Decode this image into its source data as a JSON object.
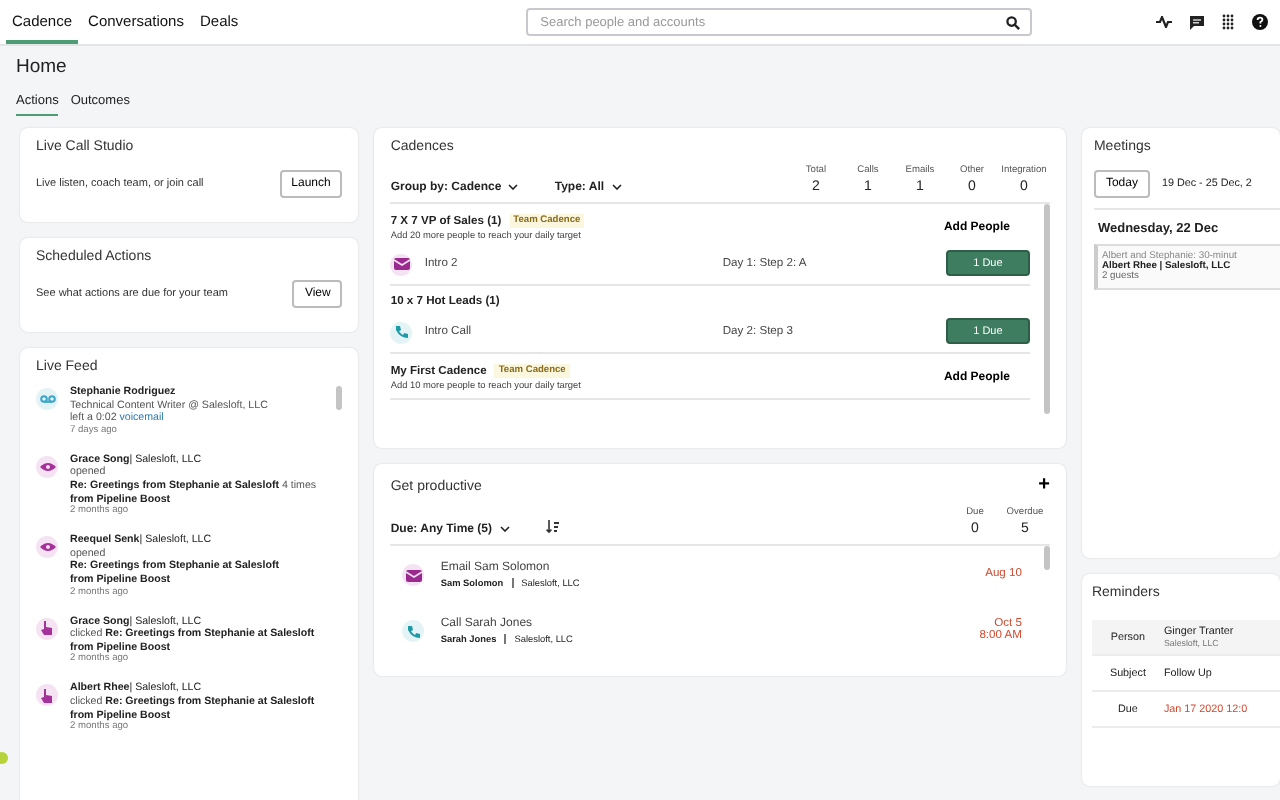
{
  "nav": {
    "tabs": [
      {
        "label": "Cadence",
        "selected": true
      },
      {
        "label": "Conversations",
        "selected": false
      },
      {
        "label": "Deals",
        "selected": false
      }
    ],
    "search": {
      "placeholder": "Search people and accounts"
    }
  },
  "page": {
    "title": "Home",
    "tabs": [
      {
        "label": "Actions",
        "selected": true
      },
      {
        "label": "Outcomes",
        "selected": false
      }
    ]
  },
  "live_call_studio": {
    "title": "Live Call Studio",
    "text": "Live listen, coach team, or join call",
    "button": "Launch"
  },
  "scheduled_actions": {
    "title": "Scheduled Actions",
    "text": "See what actions are due for your team",
    "button": "View"
  },
  "live_feed": {
    "title": "Live Feed",
    "items": [
      {
        "kind": "voicemail",
        "name": "**Stephanie Rodriguez**",
        "lines": [
          "Technical Content Writer @ Salesloft, LLC"
        ],
        "action": "left a 0:02",
        "link": "voicemail",
        "time": "7 days ago"
      },
      {
        "kind": "view",
        "name": "**Grace Song**| Salesloft, LLC",
        "lines": [
          "opened",
          "**Re: Greetings from Stephanie at Salesloft** 4 times",
          "**from Pipeline Boost**"
        ],
        "time": "2 months ago"
      },
      {
        "kind": "view",
        "name": "**Reequel Senk**| Salesloft, LLC",
        "lines": [
          "opened",
          "**Re: Greetings from Stephanie at Salesloft**",
          "**from Pipeline Boost**"
        ],
        "time": "2 months ago"
      },
      {
        "kind": "click",
        "name": "**Grace Song**| Salesloft, LLC",
        "lines": [
          "clicked **Re: Greetings from Stephanie at Salesloft**",
          "**from Pipeline Boost**"
        ],
        "time": "2 months ago"
      },
      {
        "kind": "click",
        "name": "**Albert Rhee**| Salesloft, LLC",
        "lines": [
          "clicked **Re: Greetings from Stephanie at Salesloft**",
          "**from Pipeline Boost**"
        ],
        "time": "2 months ago"
      }
    ]
  },
  "cadences": {
    "title": "Cadences",
    "group_by": "Group by: Cadence",
    "type": "Type: All",
    "counts": [
      {
        "label": "Total",
        "value": "2"
      },
      {
        "label": "Calls",
        "value": "1"
      },
      {
        "label": "Emails",
        "value": "1"
      },
      {
        "label": "Other",
        "value": "0"
      },
      {
        "label": "Integration",
        "value": "0"
      }
    ],
    "groups": [
      {
        "name": "7 X 7 VP of Sales (1)",
        "tag": "Team Cadence",
        "note": "Add 20 more people to reach your daily target",
        "action": "Add People",
        "steps": [
          {
            "kind": "email",
            "name": "Intro 2",
            "day": "Day 1: Step 2: A",
            "button": "1 Due"
          }
        ]
      },
      {
        "name": "10 x 7 Hot Leads (1)",
        "steps": [
          {
            "kind": "call",
            "name": "Intro Call",
            "day": "Day 2: Step 3",
            "button": "1 Due"
          }
        ]
      },
      {
        "name": "My First Cadence",
        "tag": "Team Cadence",
        "note": "Add 10 more people to reach your daily target",
        "action": "Add People"
      }
    ]
  },
  "get_productive": {
    "title": "Get productive",
    "add": "+",
    "filter": "Due: Any Time (5)",
    "counts": [
      {
        "label": "Due",
        "value": "0"
      },
      {
        "label": "Overdue",
        "value": "5"
      }
    ],
    "tasks": [
      {
        "kind": "email",
        "title": "Email Sam Solomon",
        "person": "Sam Solomon",
        "company": "Salesloft, LLC",
        "due": [
          "Aug 10"
        ]
      },
      {
        "kind": "call",
        "title": "Call Sarah Jones",
        "person": "Sarah Jones",
        "company": "Salesloft, LLC",
        "due": [
          "Oct 5",
          "8:00 AM"
        ]
      }
    ]
  },
  "meetings": {
    "title": "Meetings",
    "today": "Today",
    "range": "19 Dec - 25 Dec, 2",
    "day": "Wednesday, 22 Dec",
    "event": {
      "title": "Albert and Stephanie: 30-minut",
      "who": "Albert Rhee | Salesloft, LLC",
      "guests": "2 guests"
    }
  },
  "reminders": {
    "title": "Reminders",
    "rows": [
      {
        "label": "Person",
        "value": "Ginger Tranter",
        "sub": "Salesloft, LLC",
        "overdue": false
      },
      {
        "label": "Subject",
        "value": "Follow Up",
        "overdue": false
      },
      {
        "label": "Due",
        "value": "Jan 17 2020 12:0",
        "overdue": true
      }
    ]
  }
}
